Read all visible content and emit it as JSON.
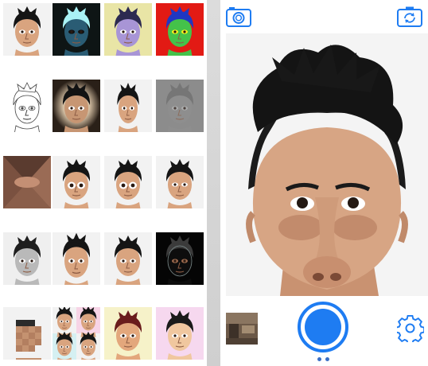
{
  "app": {
    "accent_color": "#1e7cf2"
  },
  "filters": {
    "rows": [
      [
        "original",
        "negative",
        "posterize",
        "thermal"
      ],
      [
        "sketch",
        "vignette",
        "squeeze",
        "emboss"
      ],
      [
        "tunnel",
        "big-eyes",
        "wide-eyes",
        "pinch"
      ],
      [
        "grayscale",
        "stretch",
        "bulge",
        "glow-edges"
      ],
      [
        "pixelate",
        "quad-grid",
        "warm-tint",
        "pop-tint"
      ]
    ]
  },
  "camera": {
    "top_left_icon": "camera-icon",
    "top_right_icon": "switch-camera-icon",
    "preview_effect": "bulge",
    "settings_icon": "gear-icon",
    "shutter_icon": "shutter-icon",
    "page_dots": 2,
    "active_page": 0
  }
}
